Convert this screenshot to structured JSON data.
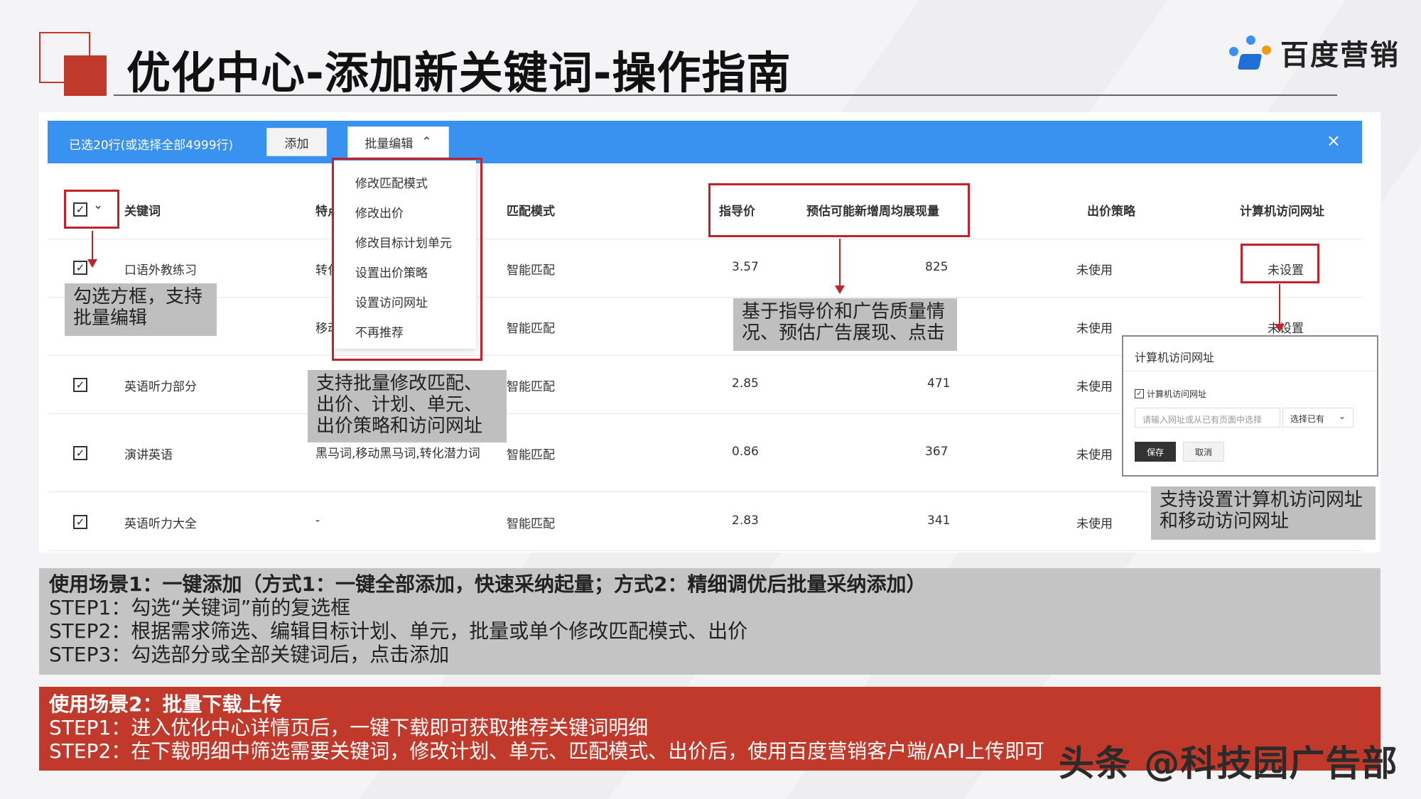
{
  "header": {
    "title": "优化中心-添加新关键词-操作指南",
    "brand": "百度营销"
  },
  "toolbar": {
    "selection_text": "已选20行(或选择全部4999行)",
    "add_label": "添加",
    "batch_edit_label": "批量编辑",
    "batch_edit_chevron": "⌃",
    "close_label": "×"
  },
  "dropdown": {
    "items": [
      "修改匹配模式",
      "修改出价",
      "修改目标计划单元",
      "设置出价策略",
      "设置访问网址",
      "不再推荐"
    ]
  },
  "table": {
    "headers": {
      "keyword": "关键词",
      "feature": "特点",
      "match": "匹配模式",
      "price": "指导价",
      "impressions": "预估可能新增周均展现量",
      "strategy": "出价策略",
      "url": "计算机访问网址"
    },
    "rows": [
      {
        "keyword": "口语外教练习",
        "feature": "转化",
        "match": "智能匹配",
        "price": "3.57",
        "impressions": "825",
        "strategy": "未使用",
        "url": "未设置"
      },
      {
        "keyword": "",
        "feature": "移动",
        "match": "智能匹配",
        "price": "",
        "impressions": "",
        "strategy": "未使用",
        "url": "未设置"
      },
      {
        "keyword": "英语听力部分",
        "feature": "",
        "match": "智能匹配",
        "price": "2.85",
        "impressions": "471",
        "strategy": "未使用",
        "url": ""
      },
      {
        "keyword": "演讲英语",
        "feature": "黑马词,移动黑马词,转化潜力词",
        "match": "智能匹配",
        "price": "0.86",
        "impressions": "367",
        "strategy": "未使用",
        "url": ""
      },
      {
        "keyword": "英语听力大全",
        "feature": "-",
        "match": "智能匹配",
        "price": "2.83",
        "impressions": "341",
        "strategy": "未使用",
        "url": ""
      }
    ],
    "check_mark": "✓",
    "header_chevron": "⌄"
  },
  "annotations": {
    "checkbox_note": "勾选方框，支持批量编辑",
    "batch_note": "支持批量修改匹配、出价、计划、单元、出价策略和访问网址",
    "price_note": "基于指导价和广告质量情况、预估广告展现、点击",
    "url_note": "支持设置计算机访问网址和移动访问网址"
  },
  "popup": {
    "title": "计算机访问网址",
    "checkbox_label": "计算机访问网址",
    "input_placeholder": "请输入网址或从已有页面中选择",
    "select_label": "选择已有",
    "save_label": "保存",
    "cancel_label": "取消"
  },
  "scenario1": {
    "heading": "使用场景1：一键添加（方式1：一键全部添加，快速采纳起量；方式2：精细调优后批量采纳添加）",
    "steps": [
      "STEP1：勾选“关键词”前的复选框",
      "STEP2：根据需求筛选、编辑目标计划、单元，批量或单个修改匹配模式、出价",
      "STEP3：勾选部分或全部关键词后，点击添加"
    ]
  },
  "scenario2": {
    "heading": "使用场景2：批量下载上传",
    "steps": [
      "STEP1：进入优化中心详情页后，一键下载即可获取推荐关键词明细",
      "STEP2：在下载明细中筛选需要关键词，修改计划、单元、匹配模式、出价后，使用百度营销客户端/API上传即可"
    ]
  },
  "watermark": "头条 @科技园广告部",
  "colors": {
    "accent_red": "#c0392b",
    "toolbar_blue": "#3a92f0"
  }
}
